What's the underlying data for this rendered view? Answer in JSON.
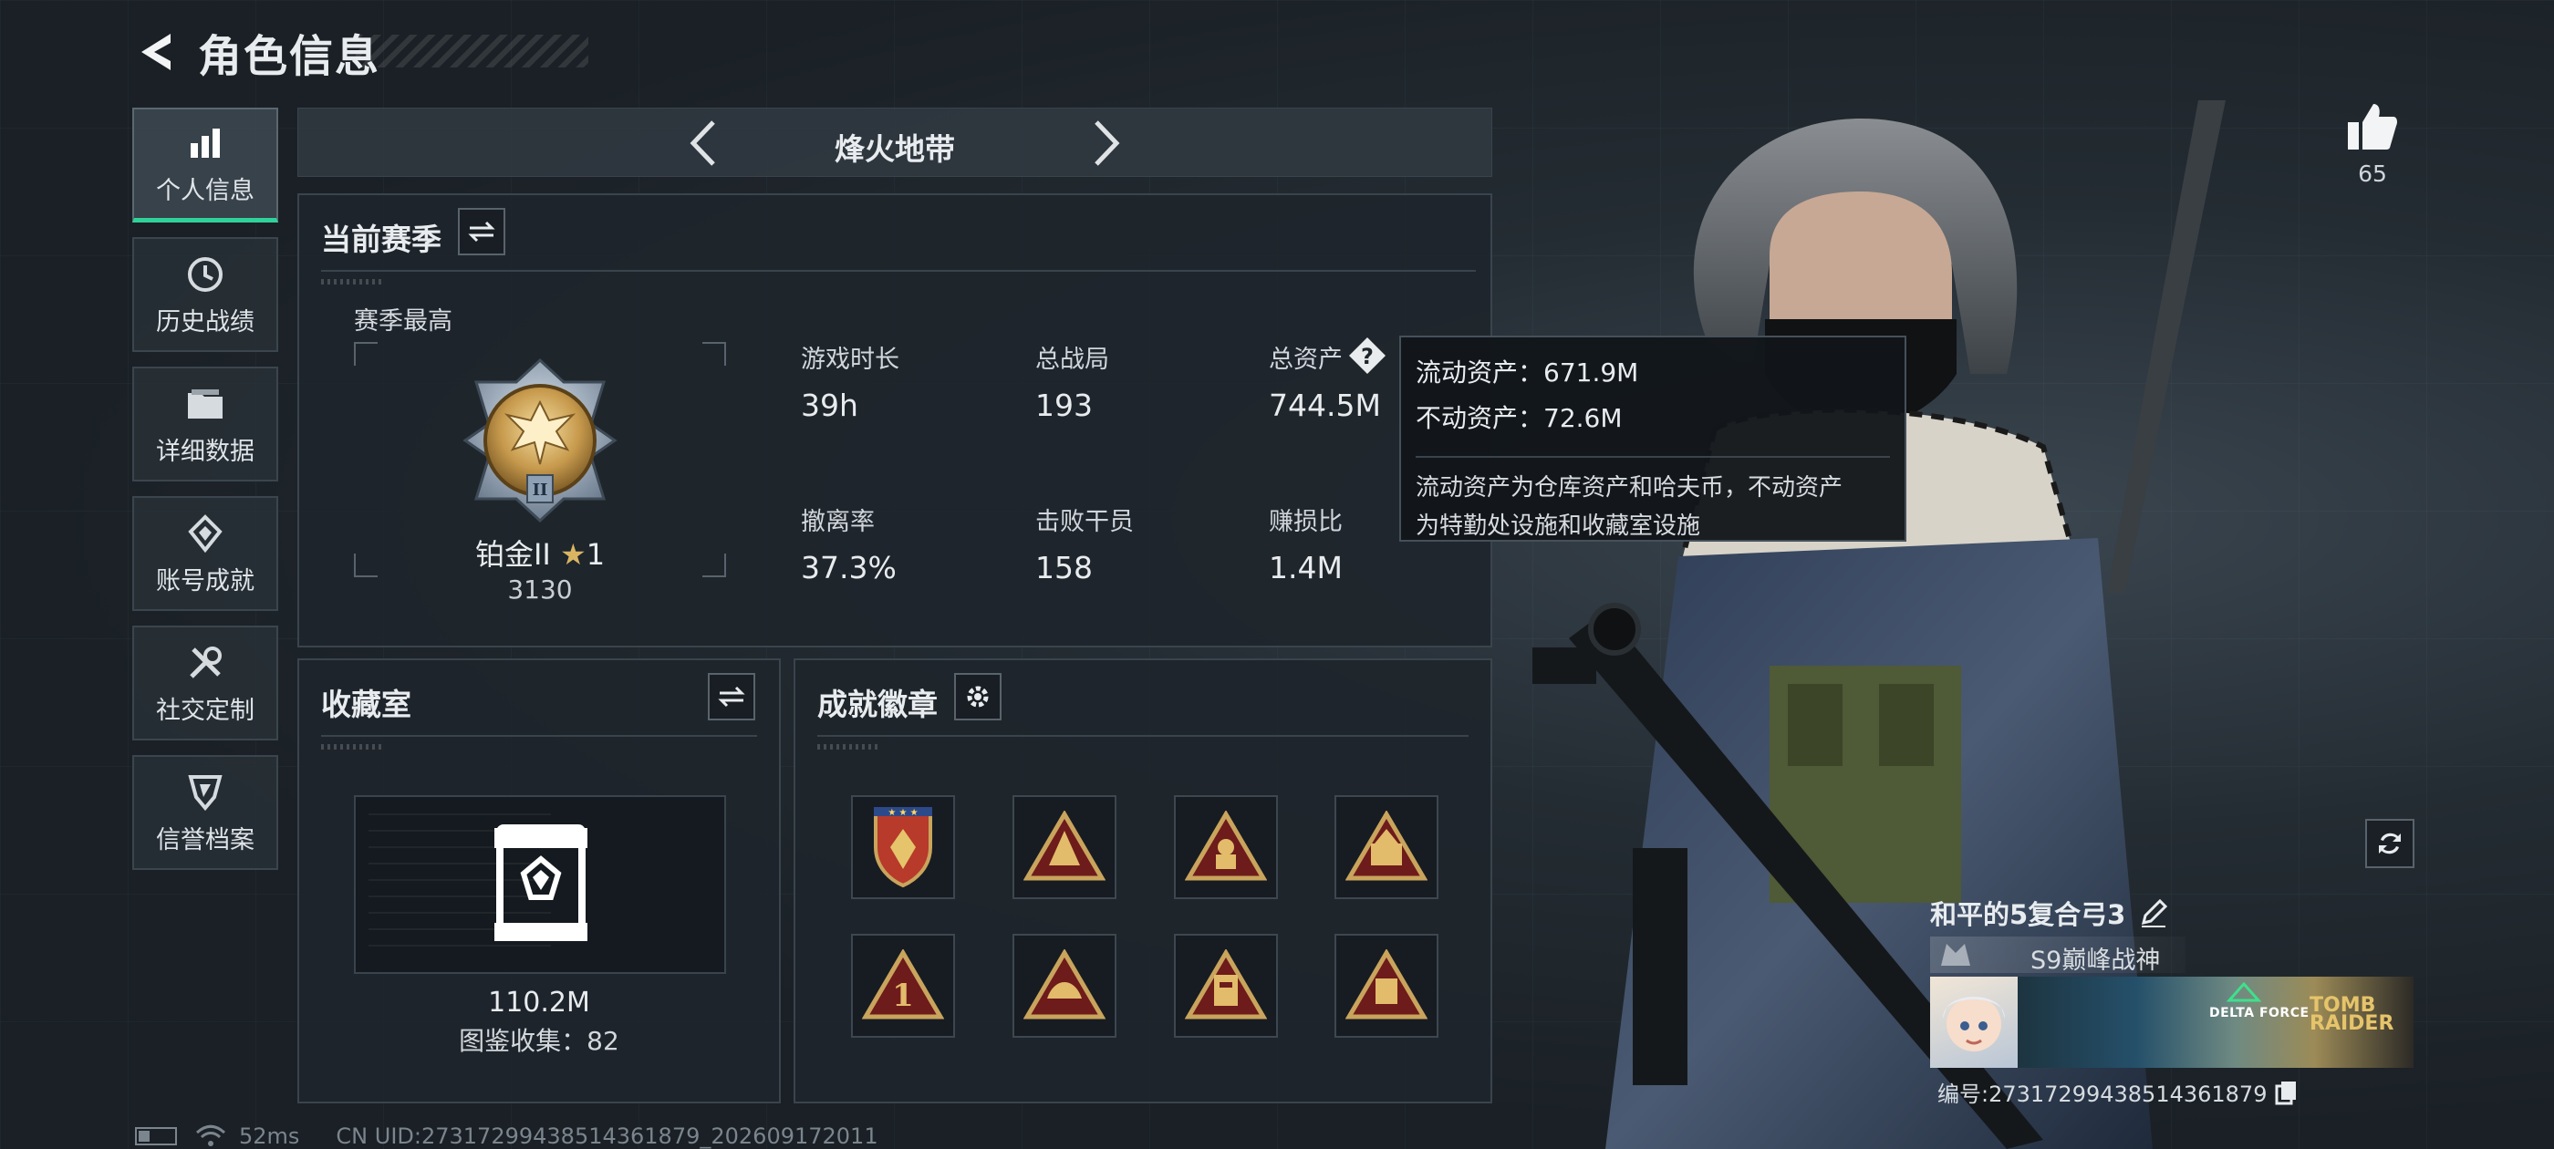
{
  "header": {
    "title": "角色信息"
  },
  "sidebar": {
    "items": [
      {
        "label": "个人信息",
        "icon": "bar-chart-icon",
        "active": true
      },
      {
        "label": "历史战绩",
        "icon": "history-icon"
      },
      {
        "label": "详细数据",
        "icon": "folder-icon"
      },
      {
        "label": "账号成就",
        "icon": "achievement-icon"
      },
      {
        "label": "社交定制",
        "icon": "tools-icon"
      },
      {
        "label": "信誉档案",
        "icon": "shield-icon"
      }
    ]
  },
  "mode_nav": {
    "title": "烽火地带"
  },
  "season": {
    "title": "当前赛季",
    "best_label": "赛季最高",
    "rank_name": "铂金II",
    "rank_stars": "1",
    "rank_score": "3130",
    "stats": [
      {
        "label": "游戏时长",
        "value": "39h"
      },
      {
        "label": "总战局",
        "value": "193"
      },
      {
        "label": "总资产",
        "value": "744.5M"
      },
      {
        "label": "撤离率",
        "value": "37.3%"
      },
      {
        "label": "击败干员",
        "value": "158"
      },
      {
        "label": "赚损比",
        "value": "1.4M"
      }
    ]
  },
  "tooltip": {
    "liquid": "流动资产：671.9M",
    "fixed": "不动资产：72.6M",
    "desc_line1": "流动资产为仓库资产和哈夫币，不动资产",
    "desc_line2": "为特勤处设施和收藏室设施"
  },
  "collection": {
    "title": "收藏室",
    "value": "110.2M",
    "count": "图鉴收集：82"
  },
  "badges": {
    "title": "成就徽章",
    "items": [
      "badge-1",
      "badge-2",
      "badge-3",
      "badge-4",
      "badge-5",
      "badge-6",
      "badge-7",
      "badge-8"
    ]
  },
  "profile": {
    "likes": "65",
    "name": "和平的5复合弓3",
    "title": "S9巅峰战神",
    "id": "编号:2731729943851436187​9",
    "banner_logo_1": "DELTA FORCE",
    "banner_logo_2": "TOMB RAIDER"
  },
  "status_bar": {
    "ping": "52ms",
    "uid": "CN UID:27317299438514361879_202609172011"
  },
  "colors": {
    "accent": "#2fd39a",
    "gold": "#c9a45c",
    "panel": "#1e252b"
  }
}
